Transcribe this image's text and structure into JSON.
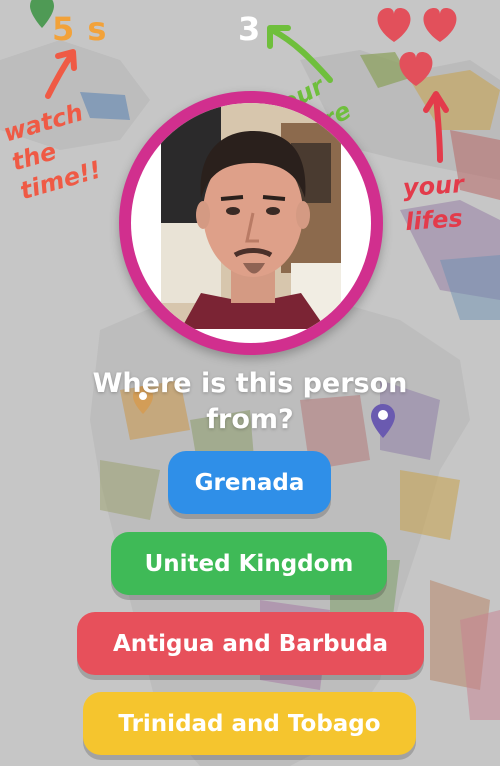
{
  "hud": {
    "timer": "5 s",
    "score": "3",
    "lives": 3
  },
  "annotations": {
    "watch_time_line1": "watch the",
    "watch_time_line2": "time!!",
    "score_line1": "your",
    "score_line2": "score",
    "lives_line1": "your",
    "lives_line2": "lifes"
  },
  "question": {
    "line1": "Where is this person",
    "line2": "from?"
  },
  "answers": [
    {
      "label": "Grenada",
      "color": "#2f8fe8"
    },
    {
      "label": "United Kingdom",
      "color": "#3fba57"
    },
    {
      "label": "Antigua and Barbuda",
      "color": "#e7505b"
    },
    {
      "label": "Trinidad and Tobago",
      "color": "#f5c52e"
    }
  ],
  "colors": {
    "heart": "#e2505b",
    "avatar_ring": "#d12f8e",
    "timer": "#f2a23a",
    "map_background": "#c4c4c4"
  },
  "icons": {
    "heart": "heart-icon",
    "map_pin": "map-pin-icon"
  }
}
